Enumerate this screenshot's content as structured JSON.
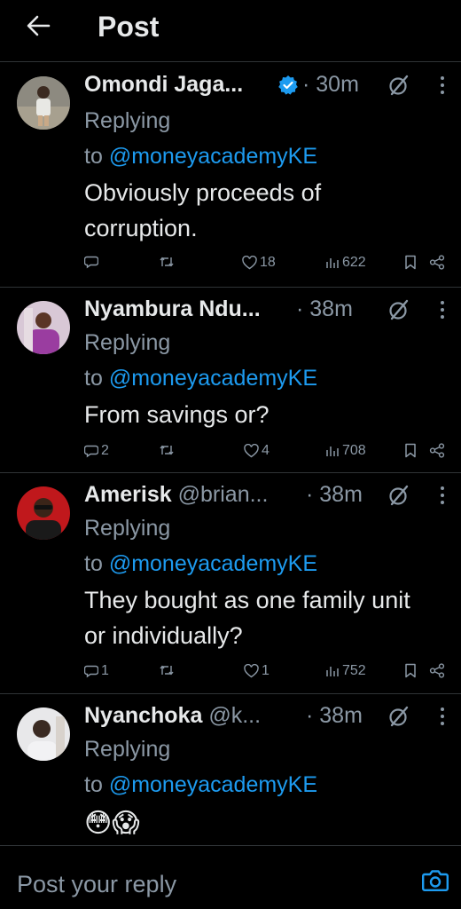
{
  "header": {
    "title": "Post"
  },
  "replies": [
    {
      "name": "Omondi Jaga...",
      "handle": "",
      "verified": true,
      "time": "· 30m",
      "replying_prefix": "Replying",
      "replying_to": "to",
      "mention": "@moneyacademyKE",
      "text_lines": [
        "Obviously proceeds of",
        "corruption."
      ],
      "stats": {
        "replies": "",
        "likes": "18",
        "views": "622"
      }
    },
    {
      "name": "Nyambura Ndu...",
      "handle": "",
      "verified": false,
      "time": "· 38m",
      "replying_prefix": "Replying",
      "replying_to": "to",
      "mention": "@moneyacademyKE",
      "text_lines": [
        "From savings or?"
      ],
      "stats": {
        "replies": "2",
        "likes": "4",
        "views": "708"
      }
    },
    {
      "name": "Amerisk",
      "handle": "@brian...",
      "verified": false,
      "time": "· 38m",
      "replying_prefix": "Replying",
      "replying_to": "to",
      "mention": "@moneyacademyKE",
      "text_lines": [
        "They bought as one family unit",
        "or individually?"
      ],
      "stats": {
        "replies": "1",
        "likes": "1",
        "views": "752"
      }
    },
    {
      "name": "Nyanchoka",
      "handle": "@k...",
      "verified": false,
      "time": "· 38m",
      "replying_prefix": "Replying",
      "replying_to": "to",
      "mention": "@moneyacademyKE",
      "text_lines": [
        "😳😱"
      ],
      "stats": {
        "replies": "",
        "likes": "",
        "views": ""
      }
    }
  ],
  "composer": {
    "placeholder": "Post your reply"
  },
  "colors": {
    "accent": "#1d9bf0",
    "muted": "#8b98a5",
    "border": "#2f3336",
    "background": "#000000"
  }
}
